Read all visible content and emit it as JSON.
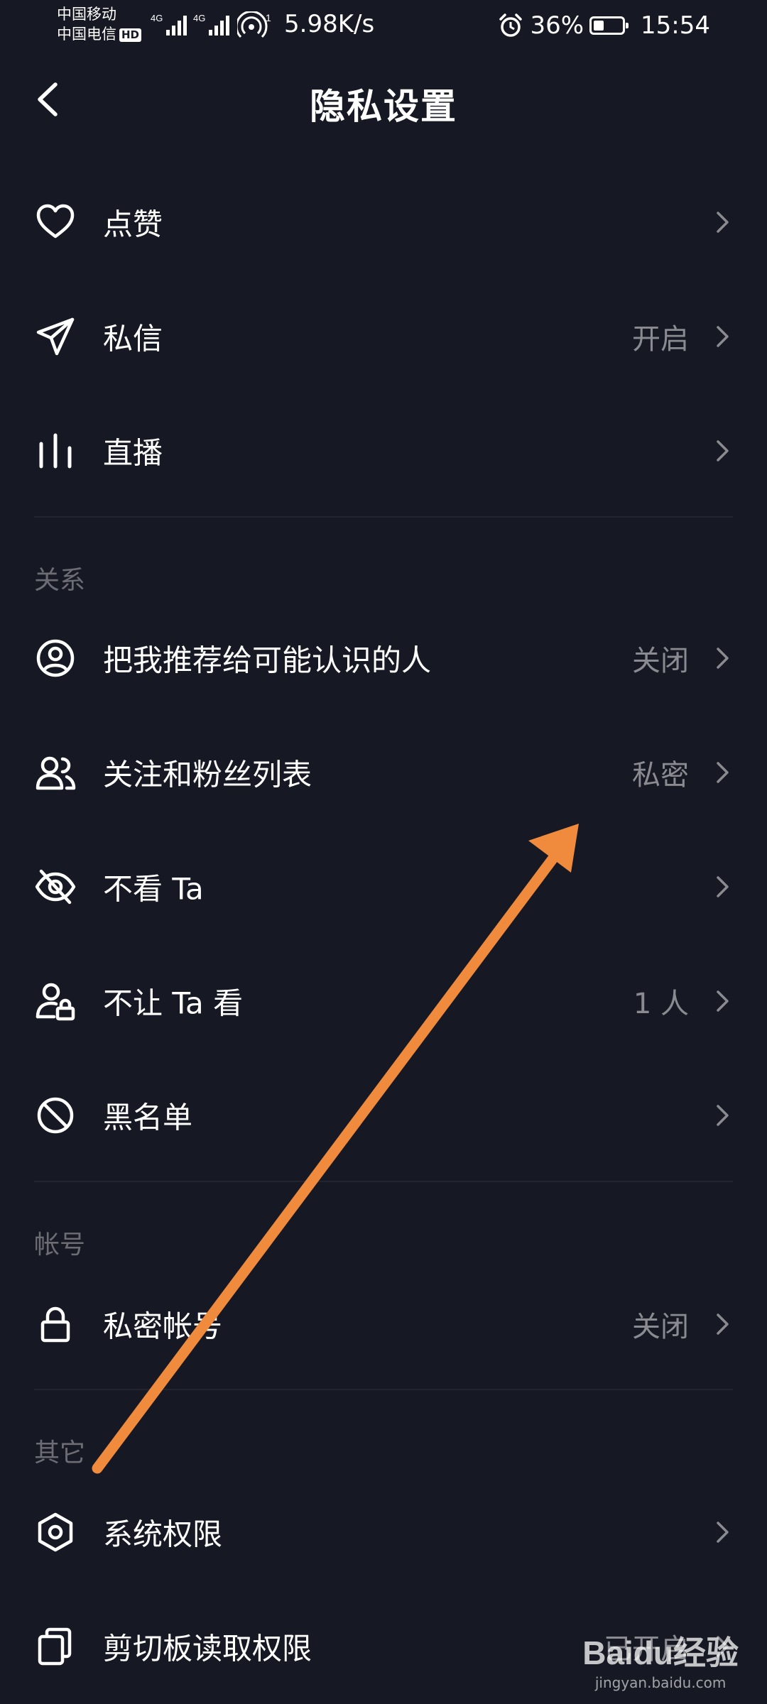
{
  "status_bar": {
    "carrier_1": "中国移动",
    "carrier_2": "中国电信",
    "hd_badge": "HD",
    "network_1": "4G",
    "network_2": "4G",
    "hotspot_count": "1",
    "net_speed": "5.98K/s",
    "battery_percent": "36%",
    "battery_level": 0.36,
    "time": "15:54"
  },
  "header": {
    "title": "隐私设置"
  },
  "rows": {
    "likes": {
      "label": "点赞",
      "value": ""
    },
    "messages": {
      "label": "私信",
      "value": "开启"
    },
    "live": {
      "label": "直播",
      "value": ""
    },
    "recommend": {
      "label": "把我推荐给可能认识的人",
      "value": "关闭"
    },
    "follow_list": {
      "label": "关注和粉丝列表",
      "value": "私密"
    },
    "dont_see": {
      "label": "不看 Ta",
      "value": ""
    },
    "dont_let_see": {
      "label": "不让 Ta 看",
      "value": "1 人"
    },
    "blacklist": {
      "label": "黑名单",
      "value": ""
    },
    "private_account": {
      "label": "私密帐号",
      "value": "关闭"
    },
    "system_perm": {
      "label": "系统权限",
      "value": ""
    },
    "clipboard": {
      "label": "剪切板读取权限",
      "value": "已开启"
    }
  },
  "sections": {
    "relations": "关系",
    "account": "帐号",
    "other": "其它"
  },
  "watermark": {
    "logo": "Baidu经验",
    "url": "jingyan.baidu.com"
  },
  "colors": {
    "background": "#161823",
    "text": "#ffffff",
    "secondary_text": "#8a8b91",
    "section_text": "#6c6d74",
    "arrow": "#f08a3c"
  }
}
